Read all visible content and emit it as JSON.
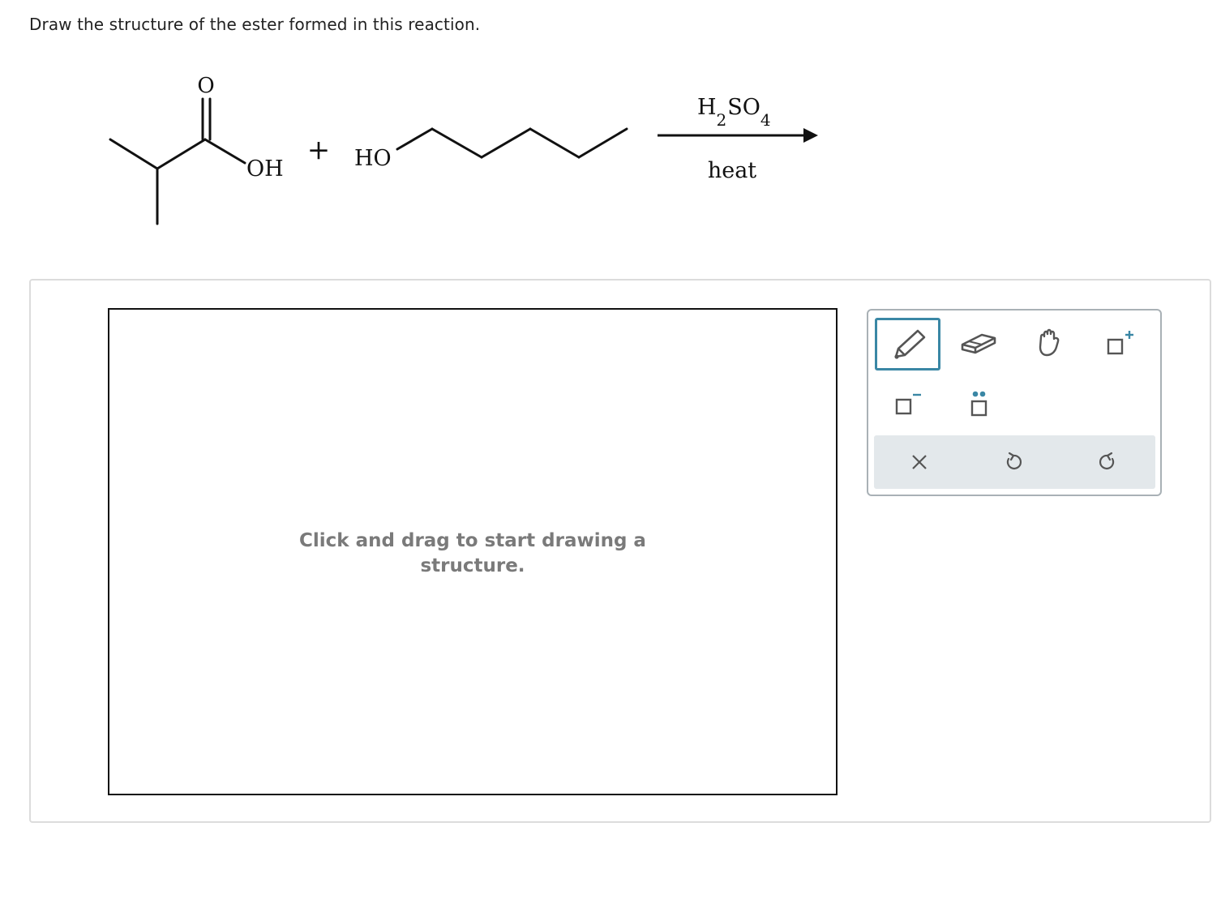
{
  "question": {
    "text": "Draw the structure of the ester formed in this reaction."
  },
  "reaction": {
    "carboxylic_acid": {
      "carbonyl_oxygen": "O",
      "hydroxyl": "OH"
    },
    "plus": "+",
    "alcohol": {
      "hydroxyl": "HO"
    },
    "catalyst": {
      "h": "H",
      "h_sub": "2",
      "so": "SO",
      "o_sub": "4"
    },
    "condition": "heat"
  },
  "canvas": {
    "hint": "Click and drag to start drawing a structure."
  },
  "tools": [
    {
      "name": "pencil-tool",
      "icon": "pencil-icon",
      "selected": true
    },
    {
      "name": "eraser-tool",
      "icon": "eraser-icon",
      "selected": false
    },
    {
      "name": "hand-tool",
      "icon": "hand-icon",
      "selected": false
    },
    {
      "name": "positive-charge-tool",
      "icon": "positive-charge-icon",
      "selected": false
    },
    {
      "name": "negative-charge-tool",
      "icon": "negative-charge-icon",
      "selected": false
    },
    {
      "name": "lone-pair-tool",
      "icon": "lone-pair-icon",
      "selected": false
    }
  ],
  "actions": [
    {
      "name": "clear-button",
      "icon": "close-icon"
    },
    {
      "name": "undo-button",
      "icon": "undo-icon"
    },
    {
      "name": "redo-button",
      "icon": "redo-icon"
    }
  ],
  "colors": {
    "accent": "#3a87a5",
    "charge_blue": "#3a87a5",
    "hint_text": "#7a7a7a",
    "action_bar_bg": "#e3e8eb",
    "panel_border": "#dcdcdc"
  }
}
